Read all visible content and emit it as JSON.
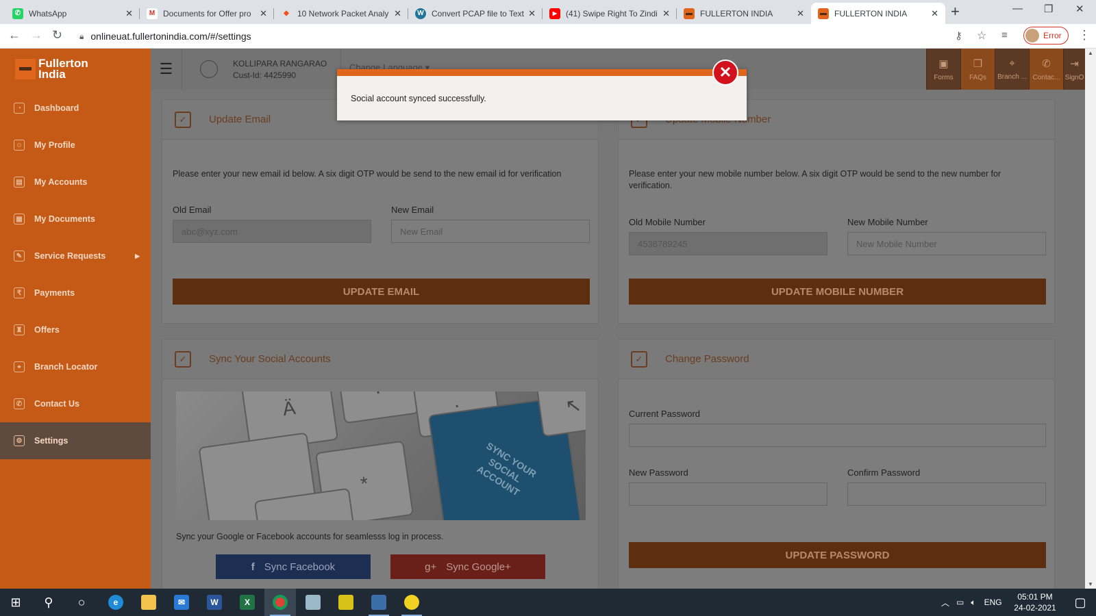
{
  "browser": {
    "tabs": [
      {
        "title": "WhatsApp",
        "color": "#25d366",
        "glyph": "✆"
      },
      {
        "title": "Documents for Offer pro",
        "color": "#ffffff",
        "glyph": "M"
      },
      {
        "title": "10 Network Packet Analy",
        "color": "#f4511e",
        "glyph": "◆"
      },
      {
        "title": "Convert PCAP file to Text",
        "color": "#21759b",
        "glyph": "W"
      },
      {
        "title": "(41) Swipe Right To Zindi",
        "color": "#ff0000",
        "glyph": "▶"
      },
      {
        "title": "FULLERTON INDIA",
        "color": "#e0661d",
        "glyph": "▬"
      },
      {
        "title": "FULLERTON INDIA",
        "color": "#e0661d",
        "glyph": "▬"
      }
    ],
    "url": "onlineuat.fullertonindia.com/#/settings",
    "profile_label": "Error"
  },
  "app": {
    "logo_line1": "Fullerton",
    "logo_line2": "India",
    "menu": [
      {
        "label": "Dashboard",
        "icon": "◔"
      },
      {
        "label": "My Profile",
        "icon": "☺"
      },
      {
        "label": "My Accounts",
        "icon": "▤"
      },
      {
        "label": "My Documents",
        "icon": "▦"
      },
      {
        "label": "Service Requests",
        "icon": "✎"
      },
      {
        "label": "Payments",
        "icon": "₹"
      },
      {
        "label": "Offers",
        "icon": "♜"
      },
      {
        "label": "Branch Locator",
        "icon": "⌖"
      },
      {
        "label": "Contact Us",
        "icon": "✆"
      },
      {
        "label": "Settings",
        "icon": "⚙"
      }
    ],
    "user_name": "KOLLIPARA RANGARAO",
    "cust_id": "Cust-Id:   4425990",
    "change_language": "Change Language",
    "top_icons": [
      {
        "label": "Forms",
        "glyph": "▣"
      },
      {
        "label": "FAQs",
        "glyph": "❐"
      },
      {
        "label": "Branch ...",
        "glyph": "⌖"
      },
      {
        "label": "Contac...",
        "glyph": "✆"
      },
      {
        "label": "SignO",
        "glyph": "⇥"
      }
    ]
  },
  "update_email": {
    "title": "Update Email",
    "description": "Please enter your new email id below. A six digit OTP would be send to the new email id for verification",
    "old_label": "Old Email",
    "old_value": "abc@xyz.com",
    "new_label": "New Email",
    "new_placeholder": "New Email",
    "button": "UPDATE EMAIL"
  },
  "update_mobile": {
    "title": "Update Mobile Number",
    "description": "Please enter your new mobile number below. A six digit OTP would be send to the new number for verification.",
    "old_label": "Old Mobile Number",
    "old_value": "4536789245",
    "new_label": "New Mobile Number",
    "new_placeholder": "New Mobile Number",
    "button": "UPDATE MOBILE NUMBER"
  },
  "social": {
    "title": "Sync Your Social Accounts",
    "key_text": "SYNC YOUR SOCIAL ACCOUNT",
    "description": "Sync your Google or Facebook accounts for seamlesss log in process.",
    "facebook_button": "Sync Facebook",
    "google_button": "Sync Google+"
  },
  "password": {
    "title": "Change Password",
    "current_label": "Current Password",
    "new_label": "New Password",
    "confirm_label": "Confirm Password",
    "button": "UPDATE PASSWORD"
  },
  "modal": {
    "message": "Social account synced successfully."
  },
  "taskbar": {
    "lang": "ENG",
    "time": "05:01 PM",
    "date": "24-02-2021"
  }
}
